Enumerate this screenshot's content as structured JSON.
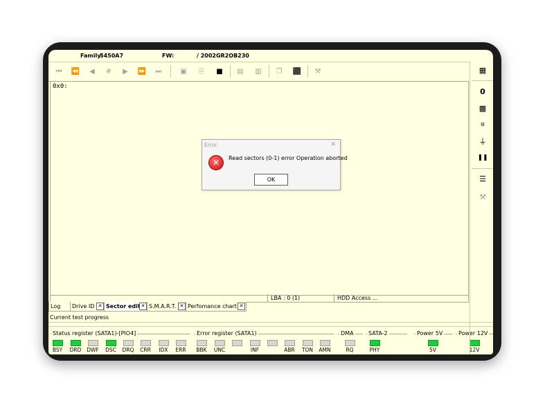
{
  "info": {
    "family_label": "Family:",
    "family_value": "5450A7",
    "fw_label": "FW:",
    "fw_value": "/ 2002GR2OB230"
  },
  "toolbar": {
    "icons": [
      "first-icon",
      "rewind-icon",
      "prev-icon",
      "goto-icon",
      "next-icon",
      "fast-forward-icon",
      "last-icon",
      "save-icon",
      "open-icon",
      "stop-icon",
      "read-icon",
      "write-icon",
      "copy-icon",
      "fill-icon",
      "tools-icon"
    ]
  },
  "editor": {
    "address": "0x0:"
  },
  "statusbar": {
    "lba": "LBA : 0 (1)",
    "access": "HDD Access ..."
  },
  "tabs": [
    {
      "label": "Log",
      "closable": false
    },
    {
      "label": "Drive ID",
      "closable": true
    },
    {
      "label": "Sector edit",
      "closable": true,
      "active": true
    },
    {
      "label": "S.M.A.R.T.",
      "closable": true
    },
    {
      "label": "Perfomance chart",
      "closable": true
    }
  ],
  "progress": {
    "label": "Current test progress"
  },
  "status_register": {
    "title": "Status register (SATA1)-[PIO4]",
    "leds": [
      {
        "label": "BSY",
        "on": true
      },
      {
        "label": "DRD",
        "on": true
      },
      {
        "label": "DWF",
        "on": false
      },
      {
        "label": "DSC",
        "on": true
      },
      {
        "label": "DRQ",
        "on": false
      },
      {
        "label": "CRR",
        "on": false
      },
      {
        "label": "IDX",
        "on": false
      },
      {
        "label": "ERR",
        "on": false
      }
    ]
  },
  "error_register": {
    "title": "Error register (SATA1)",
    "leds": [
      {
        "label": "BBK",
        "on": false
      },
      {
        "label": "UNC",
        "on": false
      },
      {
        "label": "",
        "on": false
      },
      {
        "label": "INF",
        "on": false
      },
      {
        "label": "",
        "on": false
      },
      {
        "label": "ABR",
        "on": false
      },
      {
        "label": "TON",
        "on": false
      },
      {
        "label": "AMN",
        "on": false
      }
    ]
  },
  "dma": {
    "title": "DMA",
    "led_label": "RQ",
    "on": false
  },
  "sata2": {
    "title": "SATA-2",
    "led_label": "PHY",
    "on": true
  },
  "power5": {
    "title": "Power 5V",
    "led_label": "5V",
    "on": true
  },
  "power12": {
    "title": "Power 12V",
    "led_label": "12V",
    "on": true
  },
  "dialog": {
    "title": "Error",
    "message": "Read sectors (0-1) error Operation aborted",
    "ok_label": "OK"
  }
}
